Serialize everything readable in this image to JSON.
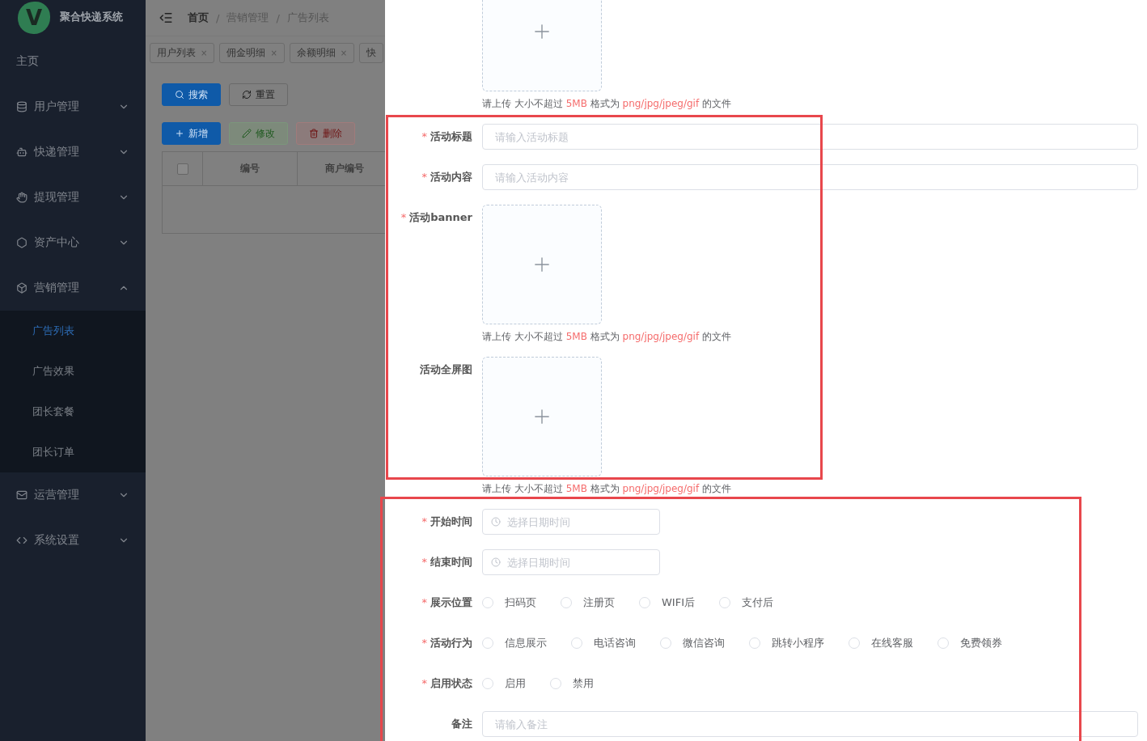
{
  "sidebar": {
    "logo": {
      "mark": "V",
      "title": "聚合快递系统"
    },
    "items": [
      {
        "kind": "link",
        "label": "主页",
        "selected": false
      },
      {
        "kind": "group",
        "label": "用户管理",
        "selected": false,
        "expanded": false
      },
      {
        "kind": "group",
        "label": "快递管理",
        "selected": false,
        "expanded": false
      },
      {
        "kind": "group",
        "label": "提现管理",
        "selected": false,
        "expanded": false
      },
      {
        "kind": "group",
        "label": "资产中心",
        "selected": false,
        "expanded": false
      },
      {
        "kind": "group",
        "label": "营销管理",
        "selected": false,
        "expanded": true,
        "children": [
          {
            "label": "广告列表",
            "selected": true
          },
          {
            "label": "广告效果",
            "selected": false
          },
          {
            "label": "团长套餐",
            "selected": false
          },
          {
            "label": "团长订单",
            "selected": false
          }
        ]
      },
      {
        "kind": "group",
        "label": "运营管理",
        "selected": false,
        "expanded": false
      },
      {
        "kind": "group",
        "label": "系统设置",
        "selected": false,
        "expanded": false
      }
    ]
  },
  "breadcrumb": {
    "separator": "/",
    "items": [
      "首页",
      "营销管理",
      "广告列表"
    ]
  },
  "tags": [
    {
      "label": "用户列表",
      "close": "×"
    },
    {
      "label": "佣金明细",
      "close": "×"
    },
    {
      "label": "余额明细",
      "close": "×"
    },
    {
      "label": "快"
    }
  ],
  "search_buttons": [
    {
      "kind": "primary",
      "label": "搜索",
      "disabled": false
    },
    {
      "kind": "default",
      "label": "重置",
      "disabled": false
    }
  ],
  "action_buttons": [
    {
      "kind": "primary",
      "label": "新增",
      "disabled": false
    },
    {
      "kind": "success",
      "label": "修改",
      "disabled": true
    },
    {
      "kind": "danger",
      "label": "删除",
      "disabled": true
    }
  ],
  "table": {
    "select_all": {
      "checked": false
    },
    "columns": [
      "编号",
      "商户编号"
    ]
  },
  "form": {
    "fields": [
      {
        "kind": "upload",
        "hint": [
          {
            "text": "请上传 大小不超过 ",
            "highlight": false
          },
          {
            "text": "5MB",
            "highlight": true
          },
          {
            "text": " 格式为 ",
            "highlight": false
          },
          {
            "text": "png/jpg/jpeg/gif",
            "highlight": true
          },
          {
            "text": " 的文件",
            "highlight": false
          }
        ]
      },
      {
        "kind": "text",
        "label": "活动标题",
        "mark": "*",
        "placeholder": "请输入活动标题"
      },
      {
        "kind": "text",
        "label": "活动内容",
        "mark": "*",
        "placeholder": "请输入活动内容"
      },
      {
        "kind": "upload",
        "label": "活动banner",
        "mark": "*",
        "hint": [
          {
            "text": "请上传 大小不超过 ",
            "highlight": false
          },
          {
            "text": "5MB",
            "highlight": true
          },
          {
            "text": " 格式为 ",
            "highlight": false
          },
          {
            "text": "png/jpg/jpeg/gif",
            "highlight": true
          },
          {
            "text": " 的文件",
            "highlight": false
          }
        ]
      },
      {
        "kind": "upload",
        "label": "活动全屏图",
        "hint": [
          {
            "text": "请上传 大小不超过 ",
            "highlight": false
          },
          {
            "text": "5MB",
            "highlight": true
          },
          {
            "text": " 格式为 ",
            "highlight": false
          },
          {
            "text": "png/jpg/jpeg/gif",
            "highlight": true
          },
          {
            "text": " 的文件",
            "highlight": false
          }
        ]
      },
      {
        "kind": "datetime",
        "label": "开始时间",
        "mark": "*",
        "placeholder": "选择日期时间"
      },
      {
        "kind": "datetime",
        "label": "结束时间",
        "mark": "*",
        "placeholder": "选择日期时间"
      },
      {
        "kind": "radio",
        "label": "展示位置",
        "mark": "*",
        "options": [
          {
            "label": "扫码页",
            "selected": false
          },
          {
            "label": "注册页",
            "selected": false
          },
          {
            "label": "WIFI后",
            "selected": false
          },
          {
            "label": "支付后",
            "selected": false
          }
        ]
      },
      {
        "kind": "radio",
        "label": "活动行为",
        "mark": "*",
        "options": [
          {
            "label": "信息展示",
            "selected": false
          },
          {
            "label": "电话咨询",
            "selected": false
          },
          {
            "label": "微信咨询",
            "selected": false
          },
          {
            "label": "跳转小程序",
            "selected": false
          },
          {
            "label": "在线客服",
            "selected": false
          },
          {
            "label": "免费领券",
            "selected": false
          }
        ]
      },
      {
        "kind": "radio",
        "label": "启用状态",
        "mark": "*",
        "options": [
          {
            "label": "启用",
            "selected": false
          },
          {
            "label": "禁用",
            "selected": false
          }
        ]
      },
      {
        "kind": "text",
        "label": "备注",
        "placeholder": "请输入备注"
      }
    ]
  }
}
